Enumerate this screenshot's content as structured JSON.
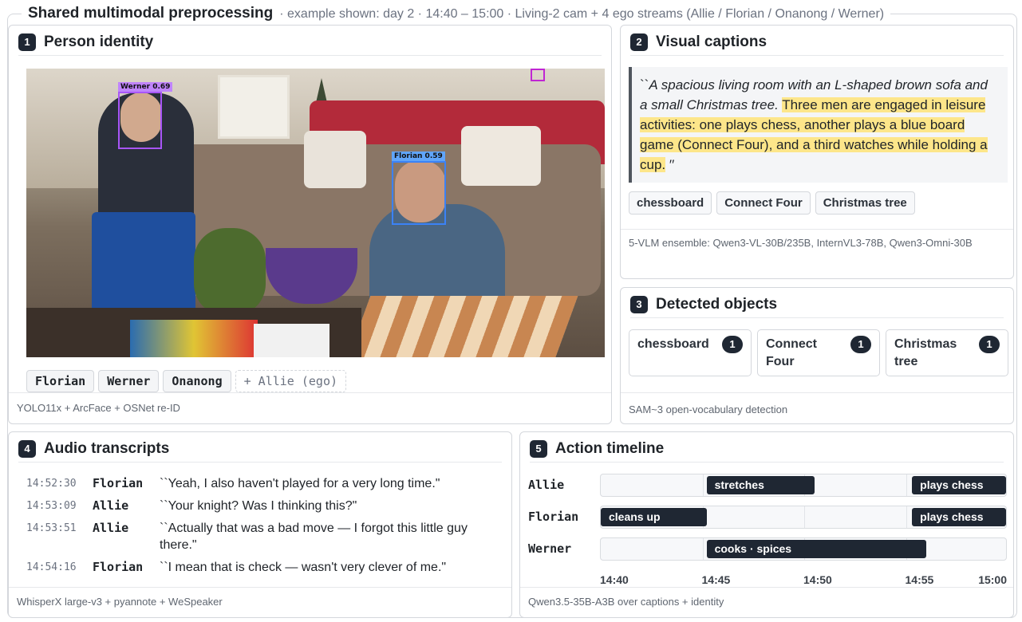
{
  "header": {
    "title": "Shared multimodal preprocessing",
    "subtitle": "·  example shown: day 2 · 14:40 – 15:00 · Living-2 cam + 4 ego streams (Allie / Florian / Onanong / Werner)"
  },
  "identity": {
    "num": "1",
    "title": "Person identity",
    "detections": [
      {
        "label": "Werner  0.69",
        "color": "#a855f7"
      },
      {
        "label": "Florian  0.59",
        "color": "#3b82f6"
      }
    ],
    "chips": [
      "Florian",
      "Werner",
      "Onanong"
    ],
    "ego_chip": "+ Allie (ego)",
    "footer": "YOLO11x + ArcFace + OSNet re-ID"
  },
  "captions": {
    "num": "2",
    "title": "Visual captions",
    "quote_open": "``",
    "quote_plain": "A spacious living room with an L-shaped brown sofa and a small Christmas tree.",
    "quote_highlight": "Three men are engaged in leisure activities: one plays chess, another plays a blue board game (Connect Four), and a third watches while holding a cup.",
    "quote_close": "′′",
    "tags": [
      "chessboard",
      "Connect Four",
      "Christmas tree"
    ],
    "footer": "5-VLM ensemble: Qwen3-VL-30B/235B, InternVL3-78B, Qwen3-Omni-30B"
  },
  "objects": {
    "num": "3",
    "title": "Detected objects",
    "items": [
      {
        "name": "chessboard",
        "count": "1"
      },
      {
        "name": "Connect Four",
        "count": "1"
      },
      {
        "name": "Christmas tree",
        "count": "1"
      }
    ],
    "footer": "SAM~3 open-vocabulary detection"
  },
  "audio": {
    "num": "4",
    "title": "Audio transcripts",
    "rows": [
      {
        "time": "14:52:30",
        "speaker": "Florian",
        "text": "``Yeah, I also haven't played for a very long time.\""
      },
      {
        "time": "14:53:09",
        "speaker": "Allie",
        "text": "``Your knight? Was I thinking this?\""
      },
      {
        "time": "14:53:51",
        "speaker": "Allie",
        "text": "``Actually that was a bad move — I forgot this little guy there.\""
      },
      {
        "time": "14:54:16",
        "speaker": "Florian",
        "text": "``I mean that is check — wasn't very clever of me.\""
      }
    ],
    "footer": "WhisperX large-v3 + pyannote + WeSpeaker"
  },
  "timeline": {
    "num": "5",
    "title": "Action timeline",
    "start_min": 40,
    "end_min": 60,
    "ticks": [
      {
        "label": "14:40",
        "min": 40
      },
      {
        "label": "14:45",
        "min": 45
      },
      {
        "label": "14:50",
        "min": 50
      },
      {
        "label": "14:55",
        "min": 55
      },
      {
        "label": "15:00",
        "min": 60
      }
    ],
    "people": [
      {
        "name": "Allie",
        "actions": [
          {
            "label": "stretches",
            "start": 45.2,
            "end": 50.5
          },
          {
            "label": "plays chess",
            "start": 55.3,
            "end": 60
          }
        ]
      },
      {
        "name": "Florian",
        "actions": [
          {
            "label": "cleans up",
            "start": 40,
            "end": 45.2
          },
          {
            "label": "plays chess",
            "start": 55.3,
            "end": 60
          }
        ]
      },
      {
        "name": "Werner",
        "actions": [
          {
            "label": "cooks · spices",
            "start": 45.2,
            "end": 56.0
          }
        ]
      }
    ],
    "footer": "Qwen3.5-35B-A3B over captions + identity"
  }
}
